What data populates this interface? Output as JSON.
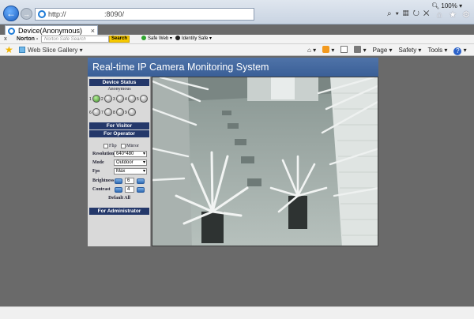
{
  "browser": {
    "address_prefix": "http://",
    "address_port": ":8090/",
    "tab_title": "Device(Anonymous)",
    "tab_close": "×",
    "norton": {
      "close": "x",
      "logo": "Norton -",
      "search_placeholder": "Norton Safe Search",
      "search_button": "Search",
      "safe_web": "Safe Web ▾",
      "identity_safe": "Identity Safe ▾"
    },
    "web_slice_gallery": "Web Slice Gallery ▾",
    "commands": {
      "page": "Page ▾",
      "safety": "Safety ▾",
      "tools": "Tools ▾",
      "help_mark": "?"
    },
    "zoom": "100%"
  },
  "app": {
    "title": "Real-time IP Camera Monitoring System",
    "device_status": "Device Status",
    "user": "Anonymous",
    "for_visitor": "For Visitor",
    "for_operator": "For Operator",
    "flip": "Flip",
    "mirror": "Mirror",
    "resolution_label": "Resolution",
    "resolution_value": "640*480",
    "mode_label": "Mode",
    "mode_value": "Outdoor",
    "fps_label": "Fps",
    "fps_value": "Max",
    "brightness_label": "Brightness",
    "brightness_value": "6",
    "contrast_label": "Contrast",
    "contrast_value": "4",
    "default_all": "Default All",
    "for_administrator": "For Administrator",
    "ptz_row1": [
      "1",
      "2",
      "3",
      "4",
      "5"
    ],
    "ptz_row2": [
      "6",
      "7",
      "8",
      "9"
    ]
  }
}
